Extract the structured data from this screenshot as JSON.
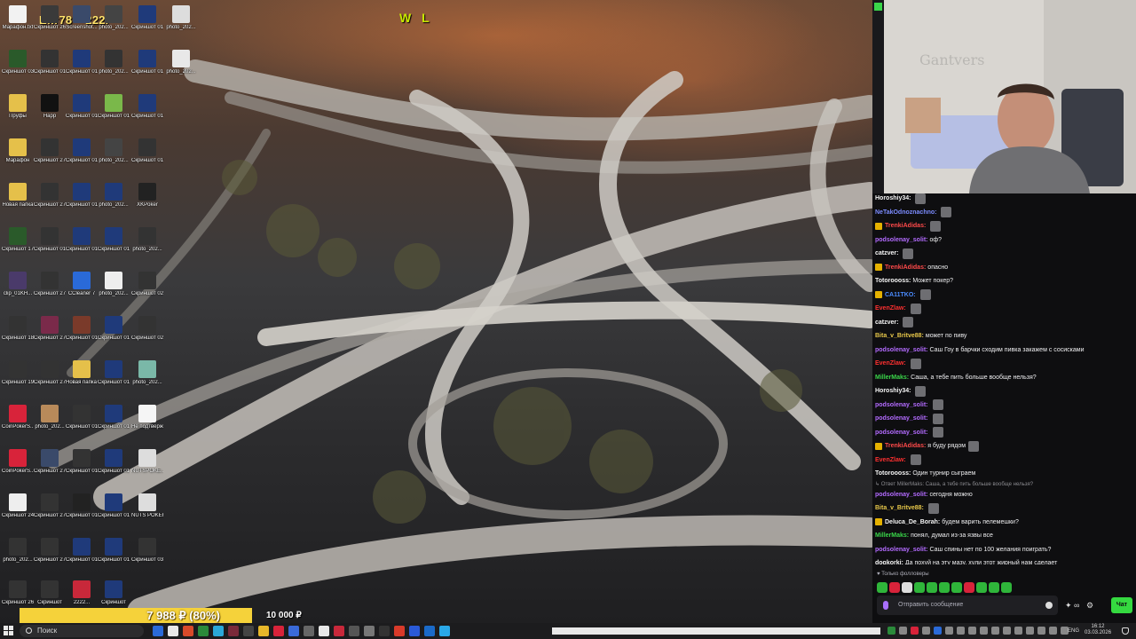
{
  "stream_overlay": {
    "title": "Efir78 – 222P",
    "wl_label": "W L",
    "donation_progress": "7 988 ₽ (80%)",
    "donation_progress_fraction": 0.8,
    "donation_goal": "10 000 ₽"
  },
  "desktop_icons": [
    {
      "label": "Марафон.txt",
      "color": "#f2f2f2"
    },
    {
      "label": "Скриншот 26-02-20...",
      "color": "#3a3a3a"
    },
    {
      "label": "Screenshot...",
      "color": "#3a4a6a"
    },
    {
      "label": "photo_202...",
      "color": "#444"
    },
    {
      "label": "Скриншот 01-03-20...",
      "color": "#1f3a7a"
    },
    {
      "label": "photo_202...",
      "color": "#ddd"
    },
    {
      "label": "Скриншот 03-03-20...",
      "color": "#2a5a2a"
    },
    {
      "label": "Скриншот 01-03-20...",
      "color": "#333"
    },
    {
      "label": "Скриншот 01-03-20...",
      "color": "#1f3a7a"
    },
    {
      "label": "photo_202...",
      "color": "#333"
    },
    {
      "label": "Скриншот 01-03-20...",
      "color": "#1f3a7a"
    },
    {
      "label": "photo_202...",
      "color": "#e8e8e8"
    },
    {
      "label": "Пруфы",
      "color": "#e5c04a"
    },
    {
      "label": "Happ",
      "color": "#111"
    },
    {
      "label": "Скриншот 01-03-20...",
      "color": "#1f3a7a"
    },
    {
      "label": "Скриншот 01-03-20...",
      "color": "#7ab84a"
    },
    {
      "label": "Скриншот 01-03-20...",
      "color": "#1f3a7a"
    },
    {
      "label": "Марафон",
      "color": "#e5c04a"
    },
    {
      "label": "Скриншот 27-02-20...",
      "color": "#333"
    },
    {
      "label": "Скриншот 01-03-20...",
      "color": "#1f3a7a"
    },
    {
      "label": "photo_202...",
      "color": "#444"
    },
    {
      "label": "Скриншот 01-03-20...",
      "color": "#333"
    },
    {
      "label": "Новая папка",
      "color": "#e5c04a"
    },
    {
      "label": "Скриншот 27-02-20...",
      "color": "#333"
    },
    {
      "label": "Скриншот 01-03-20...",
      "color": "#1f3a7a"
    },
    {
      "label": "photo_202...",
      "color": "#1f3a7a"
    },
    {
      "label": "XKPoker",
      "color": "#222"
    },
    {
      "label": "Скриншот 17-02-20...",
      "color": "#2a5a2a"
    },
    {
      "label": "Скриншот 01-03-20...",
      "color": "#333"
    },
    {
      "label": "Скриншот 01-03-20...",
      "color": "#1f3a7a"
    },
    {
      "label": "Скриншот 01-03-20...",
      "color": "#1f3a7a"
    },
    {
      "label": "photo_202...",
      "color": "#333"
    },
    {
      "label": "clip_01KH...",
      "color": "#4a3a6a"
    },
    {
      "label": "Скриншот 27-02-20...",
      "color": "#333"
    },
    {
      "label": "CCleaner 7",
      "color": "#2a6ad8"
    },
    {
      "label": "photo_202...",
      "color": "#eee"
    },
    {
      "label": "Скриншот 02-03-20...",
      "color": "#333"
    },
    {
      "label": "Скриншот 18-02-20...",
      "color": "#333"
    },
    {
      "label": "Скриншот 27-02-20...",
      "color": "#7a2a4a"
    },
    {
      "label": "Скриншот 01-03-20...",
      "color": "#7a3a2a"
    },
    {
      "label": "Скриншот 01-03-20...",
      "color": "#1f3a7a"
    },
    {
      "label": "Скриншот 02-03-20...",
      "color": "#333"
    },
    {
      "label": "Скриншот 19-02-20...",
      "color": "#333"
    },
    {
      "label": "Скриншот 27-02-20...",
      "color": "#333"
    },
    {
      "label": "Новая папка (2)",
      "color": "#e5c04a"
    },
    {
      "label": "Скриншот 01-03-20...",
      "color": "#1f3a7a"
    },
    {
      "label": "photo_202...",
      "color": "#7ab8a8"
    },
    {
      "label": "CoinPokerS...",
      "color": "#d8233a"
    },
    {
      "label": "photo_202...",
      "color": "#b88a5a"
    },
    {
      "label": "Скриншот 01-03-20...",
      "color": "#333"
    },
    {
      "label": "Скриншот 01-03-20...",
      "color": "#1f3a7a"
    },
    {
      "label": "Не подтверж...",
      "color": "#f5f5f5"
    },
    {
      "label": "CoinPokerS... (1).exe",
      "color": "#d8233a"
    },
    {
      "label": "Скриншот 27-02-20...",
      "color": "#3a4a6a"
    },
    {
      "label": "Скриншот 01-03-20...",
      "color": "#333"
    },
    {
      "label": "Скриншот 01-03-20...",
      "color": "#1f3a7a"
    },
    {
      "label": "NUTSPOKE... (1).exe",
      "color": "#ddd"
    },
    {
      "label": "Скриншот 24-02-20...",
      "color": "#eee"
    },
    {
      "label": "Скриншот 27-02-20...",
      "color": "#333"
    },
    {
      "label": "Скриншот 01-03-20...",
      "color": "#222"
    },
    {
      "label": "Скриншот 01-03-20...",
      "color": "#1f3a7a"
    },
    {
      "label": "NUTS POKER",
      "color": "#ddd"
    },
    {
      "label": "photo_202...",
      "color": "#333"
    },
    {
      "label": "Скриншот 27-02-20...",
      "color": "#333"
    },
    {
      "label": "Скриншот 01-03-20...",
      "color": "#1f3a7a"
    },
    {
      "label": "Скриншот 01-03-20...",
      "color": "#1f3a7a"
    },
    {
      "label": "Скриншот 03-03-20...",
      "color": "#333"
    },
    {
      "label": "Скриншот 26-02",
      "color": "#333"
    },
    {
      "label": "Скриншот",
      "color": "#333"
    },
    {
      "label": "2222...",
      "color": "#c8283a"
    },
    {
      "label": "Скриншот",
      "color": "#1f3a7a"
    }
  ],
  "webcam": {
    "wall_text": "Gantvers"
  },
  "chat": {
    "messages": [
      {
        "badge": false,
        "nick": "Horoshiy34:",
        "nick_color": "#f5f5f5",
        "text": "",
        "emote": true
      },
      {
        "badge": false,
        "nick": "NeTakOdnoznachno:",
        "nick_color": "#7c8cff",
        "text": "",
        "emote": true
      },
      {
        "badge": true,
        "nick": "TrenkiAdidas:",
        "nick_color": "#ff4a4a",
        "text": "",
        "emote": true
      },
      {
        "badge": false,
        "nick": "podsolenay_solit:",
        "nick_color": "#b36bff",
        "text": "оф?",
        "emote": false
      },
      {
        "badge": false,
        "nick": "catzver:",
        "nick_color": "#f5f5f5",
        "text": "",
        "emote": true
      },
      {
        "badge": true,
        "nick": "TrenkiAdidas:",
        "nick_color": "#ff4a4a",
        "text": "опасно",
        "emote": false
      },
      {
        "badge": false,
        "nick": "Totoroooss:",
        "nick_color": "#f5f5f5",
        "text": "Может покер?",
        "emote": false
      },
      {
        "badge": true,
        "nick": "CA11TKO:",
        "nick_color": "#4a8cff",
        "text": "",
        "emote": true
      },
      {
        "badge": false,
        "nick": "EvenZlaw:",
        "nick_color": "#ff3030",
        "text": "",
        "emote": true
      },
      {
        "badge": false,
        "nick": "catzver:",
        "nick_color": "#f5f5f5",
        "text": "",
        "emote": true
      },
      {
        "badge": false,
        "nick": "Bita_v_Britve88:",
        "nick_color": "#e8c84a",
        "text": "может по пиву",
        "emote": false
      },
      {
        "badge": false,
        "nick": "podsolenay_solit:",
        "nick_color": "#b36bff",
        "text": "Саш Гоу в барчки сходим пивка закажем с сосисками",
        "emote": false
      },
      {
        "badge": false,
        "nick": "EvenZlaw:",
        "nick_color": "#ff3030",
        "text": "",
        "emote": true
      },
      {
        "badge": false,
        "nick": "MillerMaks:",
        "nick_color": "#3ad64a",
        "text": "Саша, а тебе пить больше вообще нельзя?",
        "emote": false
      },
      {
        "badge": false,
        "nick": "Horoshiy34:",
        "nick_color": "#f5f5f5",
        "text": "",
        "emote": true
      },
      {
        "badge": false,
        "nick": "podsolenay_solit:",
        "nick_color": "#b36bff",
        "text": "",
        "emote": true
      },
      {
        "badge": false,
        "nick": "podsolenay_solit:",
        "nick_color": "#b36bff",
        "text": "",
        "emote": true
      },
      {
        "badge": false,
        "nick": "podsolenay_solit:",
        "nick_color": "#b36bff",
        "text": "",
        "emote": true
      },
      {
        "badge": true,
        "nick": "TrenkiAdidas:",
        "nick_color": "#ff4a4a",
        "text": "я буду рядом",
        "emote": true
      },
      {
        "badge": false,
        "nick": "EvenZlaw:",
        "nick_color": "#ff3030",
        "text": "",
        "emote": true
      },
      {
        "badge": false,
        "nick": "Totoroooss:",
        "nick_color": "#f5f5f5",
        "text": "Один турнир сыграем",
        "emote": false
      },
      {
        "reply": true,
        "text": "↳ Ответ MillerMaks: Саша, а тебе пить больше вообще нельзя?"
      },
      {
        "badge": false,
        "nick": "podsolenay_solit:",
        "nick_color": "#b36bff",
        "text": "сегодня можно",
        "emote": false
      },
      {
        "badge": false,
        "nick": "Bita_v_Britve88:",
        "nick_color": "#e8c84a",
        "text": "",
        "emote": true
      },
      {
        "badge": true,
        "nick": "Deluca_De_Borah:",
        "nick_color": "#f5f5f5",
        "text": "будем варить пелемешки?",
        "emote": false
      },
      {
        "badge": false,
        "nick": "MillerMaks:",
        "nick_color": "#3ad64a",
        "text": "понял, думал из-за язвы все",
        "emote": false
      },
      {
        "badge": false,
        "nick": "podsolenay_solit:",
        "nick_color": "#b36bff",
        "text": "Саш спины нет по 100 желания поиграть?",
        "emote": false
      },
      {
        "badge": false,
        "nick": "dogkorki:",
        "nick_color": "#f5f5f5",
        "text": "Да похуй на эту мазу. хули этот жирный нам сделает",
        "emote": false
      }
    ],
    "followers_only": "♥ Только фолловеры",
    "input_placeholder": "Отправить сообщение",
    "send_button": "Чат"
  },
  "taskbar": {
    "search_placeholder": "Поиск",
    "language": "ENG",
    "time": "16:12",
    "date": "03.03.2026"
  }
}
